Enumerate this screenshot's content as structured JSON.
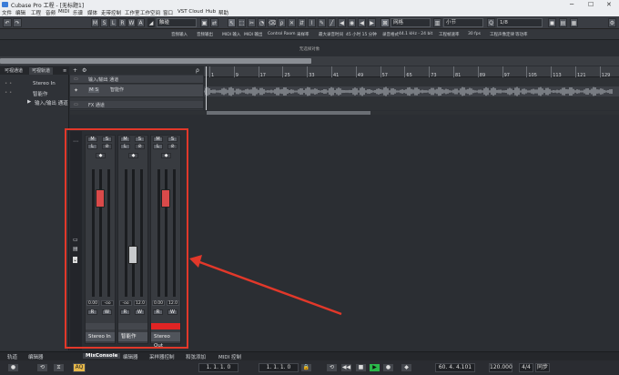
{
  "window": {
    "title": "Cubase Pro 工程 - [无标题1]",
    "min": "─",
    "max": "☐",
    "close": "✕"
  },
  "menu": [
    "文件",
    "编辑",
    "工程",
    "音频",
    "MIDI",
    "乐谱",
    "媒体",
    "走带控制",
    "工作室",
    "工作空间",
    "窗口",
    "VST Cloud",
    "Hub",
    "帮助"
  ],
  "toolbar": {
    "undo": "↶",
    "redo": "↷",
    "state_buttons": [
      "M",
      "S",
      "L",
      "R",
      "W",
      "A"
    ],
    "quantize_mode": "触碰",
    "grid_type": "网格",
    "grid_value": "小节",
    "quantize_value": "1/8"
  },
  "infobar": [
    "音频输入",
    "音频输出",
    "MIDI 输入",
    "MIDI 输出",
    "Control Room",
    "采样率",
    "最大录音时间",
    "45 小时 15 分钟",
    "录音格式",
    "44.1 kHz - 24 bit",
    "工程帧速率",
    "30 fps",
    "工程声像定律",
    "等功率"
  ],
  "selection_info": "无选择对象",
  "left_panel": {
    "tabs": [
      "可视通道",
      "可视轨道"
    ],
    "items": [
      "Stereo In",
      "智能作",
      "输入/输出 通道"
    ]
  },
  "tracks": {
    "header_icons": [
      "+",
      "⚙",
      "ρ"
    ],
    "rows": [
      {
        "label": "输入/输出 通道",
        "state": ""
      },
      {
        "label": "智能作",
        "state": "M S"
      },
      {
        "label": "FX 通道",
        "state": ""
      }
    ]
  },
  "ruler": [
    "1",
    "9",
    "17",
    "25",
    "33",
    "41",
    "49",
    "57",
    "65",
    "73",
    "81",
    "89",
    "97",
    "105",
    "113",
    "121",
    "129"
  ],
  "mixer": {
    "channels": [
      {
        "name": "Stereo In",
        "val_left": "0.00",
        "val_right": "-oo",
        "fader": 0.82,
        "color": "#d94a4a",
        "route": "R W"
      },
      {
        "name": "智能作",
        "val_left": "-oo",
        "val_right": "12.0",
        "fader": 0.3,
        "color": "#c8cacd",
        "route": "R W"
      },
      {
        "name": "Stereo Out",
        "val_left": "0.00",
        "val_right": "12.0",
        "fader": 0.82,
        "color": "#d94a4a",
        "route": "R W"
      }
    ]
  },
  "bottom_tabs": [
    "轨道",
    "编辑器",
    "MixConsole",
    "编辑器",
    "采样器控制",
    "和弦添加",
    "MIDI 控制"
  ],
  "transport": {
    "pos_left": "1. 1. 1. 0",
    "pos_right": "1. 1. 1. 0",
    "pos_primary": "60. 4. 4.101",
    "tempo": "120.000",
    "signature": "4/4",
    "punch": "AQ",
    "sync": "同步"
  }
}
